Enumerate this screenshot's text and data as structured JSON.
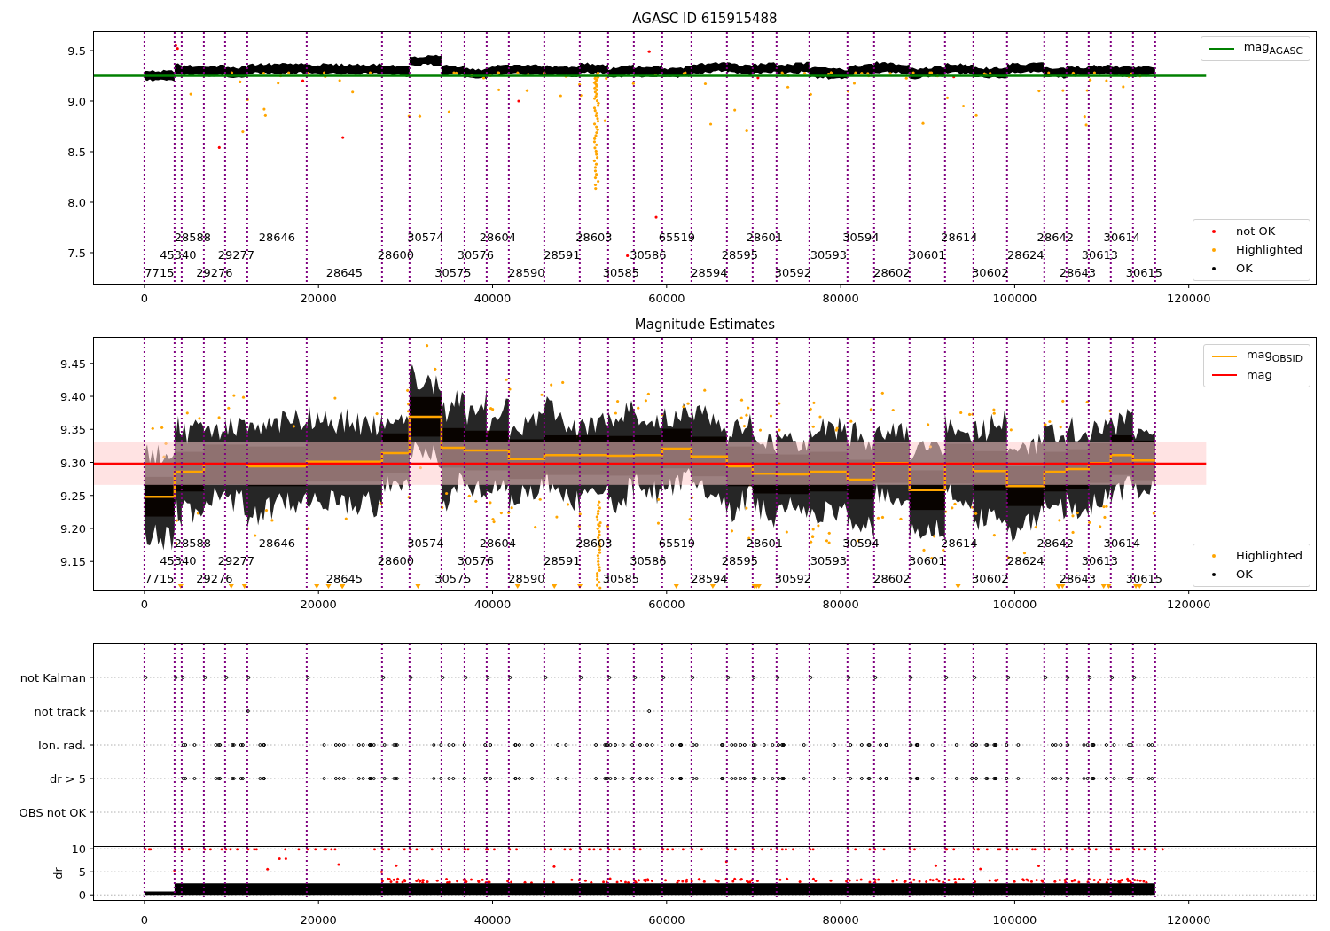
{
  "panels": [
    {
      "kind": "magnitude",
      "legend_points": [
        {
          "label": "not OK",
          "color": "#ff0000"
        },
        {
          "label": "Highlighted",
          "color": "#ffa500"
        },
        {
          "label": "OK",
          "color": "#000000"
        }
      ],
      "chart_data": {
        "type": "scatter",
        "title": "AGASC ID 615915488",
        "xlim": [
          -5900,
          134700
        ],
        "ylim": [
          7.184,
          9.693
        ],
        "xticks": [
          0,
          20000,
          40000,
          60000,
          80000,
          100000,
          120000
        ],
        "yticks": [
          {
            "value": 7.5,
            "label": "7.5"
          },
          {
            "value": 8,
            "label": "8.0"
          },
          {
            "value": 8.5,
            "label": "8.5"
          },
          {
            "value": 9,
            "label": "9.0"
          },
          {
            "value": 9.5,
            "label": "9.5"
          }
        ],
        "legend": "upper right",
        "ref_lines": [
          {
            "axis": "x",
            "value": 0
          },
          {
            "axis": "x",
            "value": 3463
          },
          {
            "axis": "x",
            "value": 4278
          },
          {
            "axis": "x",
            "value": 6825
          },
          {
            "axis": "x",
            "value": 9270
          },
          {
            "axis": "x",
            "value": 11817
          },
          {
            "axis": "x",
            "value": 18642
          },
          {
            "axis": "x",
            "value": 27300
          },
          {
            "axis": "x",
            "value": 30460
          },
          {
            "axis": "x",
            "value": 34130
          },
          {
            "axis": "x",
            "value": 36780
          },
          {
            "axis": "x",
            "value": 39325
          },
          {
            "axis": "x",
            "value": 41870
          },
          {
            "axis": "x",
            "value": 45945
          },
          {
            "axis": "x",
            "value": 50020
          },
          {
            "axis": "x",
            "value": 53280
          },
          {
            "axis": "x",
            "value": 56235
          },
          {
            "axis": "x",
            "value": 59495
          },
          {
            "axis": "x",
            "value": 62855
          },
          {
            "axis": "x",
            "value": 66930
          },
          {
            "axis": "x",
            "value": 69885
          },
          {
            "axis": "x",
            "value": 72635
          },
          {
            "axis": "x",
            "value": 76405
          },
          {
            "axis": "x",
            "value": 80785
          },
          {
            "axis": "x",
            "value": 83840
          },
          {
            "axis": "x",
            "value": 87915
          },
          {
            "axis": "x",
            "value": 91990
          },
          {
            "axis": "x",
            "value": 95250
          },
          {
            "axis": "x",
            "value": 99120
          },
          {
            "axis": "x",
            "value": 103400
          },
          {
            "axis": "x",
            "value": 105950
          },
          {
            "axis": "x",
            "value": 108500
          },
          {
            "axis": "x",
            "value": 111040
          },
          {
            "axis": "x",
            "value": 113590
          },
          {
            "axis": "x",
            "value": 116140
          }
        ],
        "series": [
          {
            "name": "mag$_{AGASC}$",
            "type": "line",
            "color": "#008000",
            "x": [
              -5900,
              122000
            ],
            "values": [
              9.25,
              9.25
            ]
          }
        ],
        "annotations": [
          "7715",
          "45340",
          "28588",
          "29276",
          "29277",
          "28646",
          "28645",
          "28600",
          "30574",
          "30575",
          "30576",
          "28604",
          "28590",
          "28591",
          "28603",
          "30585",
          "30586",
          "65519",
          "28594",
          "28595",
          "28601",
          "30592",
          "30593",
          "30594",
          "28602",
          "30601",
          "28614",
          "30602",
          "28624",
          "28642",
          "28643",
          "30613",
          "30614",
          "30615"
        ]
      }
    },
    {
      "kind": "estimates",
      "legend_points": [
        {
          "label": "Highlighted",
          "color": "#ffa500"
        },
        {
          "label": "OK",
          "color": "#000000"
        }
      ],
      "chart_data": {
        "type": "scatter",
        "title": "Magnitude Estimates",
        "xlim": [
          -5900,
          134700
        ],
        "ylim": [
          9.106,
          9.49
        ],
        "xticks": [
          0,
          20000,
          40000,
          60000,
          80000,
          100000,
          120000
        ],
        "yticks": [
          {
            "value": 9.15,
            "label": "9.15"
          },
          {
            "value": 9.2,
            "label": "9.20"
          },
          {
            "value": 9.25,
            "label": "9.25"
          },
          {
            "value": 9.3,
            "label": "9.30"
          },
          {
            "value": 9.35,
            "label": "9.35"
          },
          {
            "value": 9.4,
            "label": "9.40"
          },
          {
            "value": 9.45,
            "label": "9.45"
          }
        ],
        "legend": "upper right",
        "ref_lines": [
          {
            "axis": "x",
            "value": 0
          },
          {
            "axis": "x",
            "value": 3463
          },
          {
            "axis": "x",
            "value": 4278
          },
          {
            "axis": "x",
            "value": 6825
          },
          {
            "axis": "x",
            "value": 9270
          },
          {
            "axis": "x",
            "value": 11817
          },
          {
            "axis": "x",
            "value": 18642
          },
          {
            "axis": "x",
            "value": 27300
          },
          {
            "axis": "x",
            "value": 30460
          },
          {
            "axis": "x",
            "value": 34130
          },
          {
            "axis": "x",
            "value": 36780
          },
          {
            "axis": "x",
            "value": 39325
          },
          {
            "axis": "x",
            "value": 41870
          },
          {
            "axis": "x",
            "value": 45945
          },
          {
            "axis": "x",
            "value": 50020
          },
          {
            "axis": "x",
            "value": 53280
          },
          {
            "axis": "x",
            "value": 56235
          },
          {
            "axis": "x",
            "value": 59495
          },
          {
            "axis": "x",
            "value": 62855
          },
          {
            "axis": "x",
            "value": 66930
          },
          {
            "axis": "x",
            "value": 69885
          },
          {
            "axis": "x",
            "value": 72635
          },
          {
            "axis": "x",
            "value": 76405
          },
          {
            "axis": "x",
            "value": 80785
          },
          {
            "axis": "x",
            "value": 83840
          },
          {
            "axis": "x",
            "value": 87915
          },
          {
            "axis": "x",
            "value": 91990
          },
          {
            "axis": "x",
            "value": 95250
          },
          {
            "axis": "x",
            "value": 99120
          },
          {
            "axis": "x",
            "value": 103400
          },
          {
            "axis": "x",
            "value": 105950
          },
          {
            "axis": "x",
            "value": 108500
          },
          {
            "axis": "x",
            "value": 111040
          },
          {
            "axis": "x",
            "value": 113590
          },
          {
            "axis": "x",
            "value": 116140
          }
        ],
        "bands": [
          {
            "axis": "y",
            "from": 9.266,
            "to": 9.331,
            "color": "#ffcccc"
          }
        ],
        "series": [
          {
            "name": "mag$_{OBSID}$",
            "type": "line",
            "color": "#ffa500",
            "x": [
              0,
              3463,
              3463,
              4278,
              4278,
              6825,
              6825,
              9270,
              9270,
              11817,
              11817,
              18642,
              18642,
              27300,
              27300,
              30460,
              30460,
              34130,
              34130,
              36780,
              36780,
              39325,
              39325,
              41870,
              41870,
              45945,
              45945,
              50020,
              50020,
              53280,
              53280,
              56235,
              56235,
              59495,
              59495,
              62855,
              62855,
              66930,
              66930,
              69885,
              69885,
              72635,
              72635,
              76405,
              76405,
              80785,
              80785,
              83840,
              83840,
              87915,
              87915,
              91990,
              91990,
              95250,
              95250,
              99120,
              99120,
              103400,
              103400,
              105950,
              105950,
              108500,
              108500,
              111040,
              111040,
              113590,
              113590,
              116140
            ],
            "values": [
              9.248,
              9.248,
              9.286,
              9.286,
              9.286,
              9.286,
              9.297,
              9.297,
              9.297,
              9.297,
              9.294,
              9.294,
              9.301,
              9.301,
              9.314,
              9.314,
              9.369,
              9.369,
              9.322,
              9.322,
              9.318,
              9.318,
              9.318,
              9.318,
              9.305,
              9.305,
              9.311,
              9.311,
              9.311,
              9.311,
              9.31,
              9.31,
              9.311,
              9.311,
              9.321,
              9.321,
              9.309,
              9.309,
              9.294,
              9.294,
              9.283,
              9.283,
              9.282,
              9.282,
              9.286,
              9.286,
              9.274,
              9.274,
              9.299,
              9.299,
              9.258,
              9.258,
              9.298,
              9.298,
              9.287,
              9.287,
              9.264,
              9.264,
              9.286,
              9.286,
              9.29,
              9.29,
              9.299,
              9.299,
              9.311,
              9.311,
              9.303,
              9.303
            ]
          },
          {
            "name": "mag",
            "type": "line",
            "color": "#ff0000",
            "x": [
              -5900,
              122000
            ],
            "values": [
              9.298,
              9.298
            ]
          }
        ],
        "annotations": [
          "7715",
          "45340",
          "28588",
          "29276",
          "29277",
          "28646",
          "28645",
          "28600",
          "30574",
          "30575",
          "30576",
          "28604",
          "28590",
          "28591",
          "28603",
          "30585",
          "30586",
          "65519",
          "28594",
          "28595",
          "28601",
          "30592",
          "30593",
          "30594",
          "28602",
          "30601",
          "28614",
          "30602",
          "28624",
          "28642",
          "28643",
          "30613",
          "30614",
          "30615"
        ]
      }
    },
    {
      "kind": "flags",
      "row_labels": [
        "not Kalman",
        "not track",
        "Ion. rad.",
        "dr > 5",
        "OBS not OK"
      ]
    },
    {
      "kind": "dr",
      "chart_data": {
        "type": "scatter",
        "ylabel": "dr",
        "xlim": [
          -5900,
          134700
        ],
        "ylim": [
          -1.3,
          10.6
        ],
        "grid": true,
        "xticks": [
          0,
          20000,
          40000,
          60000,
          80000,
          100000,
          120000
        ],
        "yticks": [
          0,
          5,
          10
        ],
        "series": [
          {
            "type": "area",
            "color": "#000000",
            "x": [
              0,
              3463,
              3463,
              116140
            ],
            "values": [
              0.7,
              0.7,
              2.5,
              2.5
            ]
          }
        ],
        "ref_lines": [
          {
            "axis": "x",
            "value": 0
          },
          {
            "axis": "x",
            "value": 3463
          },
          {
            "axis": "x",
            "value": 4278
          },
          {
            "axis": "x",
            "value": 6825
          },
          {
            "axis": "x",
            "value": 9270
          },
          {
            "axis": "x",
            "value": 11817
          },
          {
            "axis": "x",
            "value": 18642
          },
          {
            "axis": "x",
            "value": 27300
          },
          {
            "axis": "x",
            "value": 30460
          },
          {
            "axis": "x",
            "value": 34130
          },
          {
            "axis": "x",
            "value": 36780
          },
          {
            "axis": "x",
            "value": 39325
          },
          {
            "axis": "x",
            "value": 41870
          },
          {
            "axis": "x",
            "value": 45945
          },
          {
            "axis": "x",
            "value": 50020
          },
          {
            "axis": "x",
            "value": 53280
          },
          {
            "axis": "x",
            "value": 56235
          },
          {
            "axis": "x",
            "value": 59495
          },
          {
            "axis": "x",
            "value": 62855
          },
          {
            "axis": "x",
            "value": 66930
          },
          {
            "axis": "x",
            "value": 69885
          },
          {
            "axis": "x",
            "value": 72635
          },
          {
            "axis": "x",
            "value": 76405
          },
          {
            "axis": "x",
            "value": 80785
          },
          {
            "axis": "x",
            "value": 83840
          },
          {
            "axis": "x",
            "value": 87915
          },
          {
            "axis": "x",
            "value": 91990
          },
          {
            "axis": "x",
            "value": 95250
          },
          {
            "axis": "x",
            "value": 99120
          },
          {
            "axis": "x",
            "value": 103400
          },
          {
            "axis": "x",
            "value": 105950
          },
          {
            "axis": "x",
            "value": 108500
          },
          {
            "axis": "x",
            "value": 111040
          },
          {
            "axis": "x",
            "value": 113590
          },
          {
            "axis": "x",
            "value": 116140
          }
        ]
      }
    }
  ]
}
